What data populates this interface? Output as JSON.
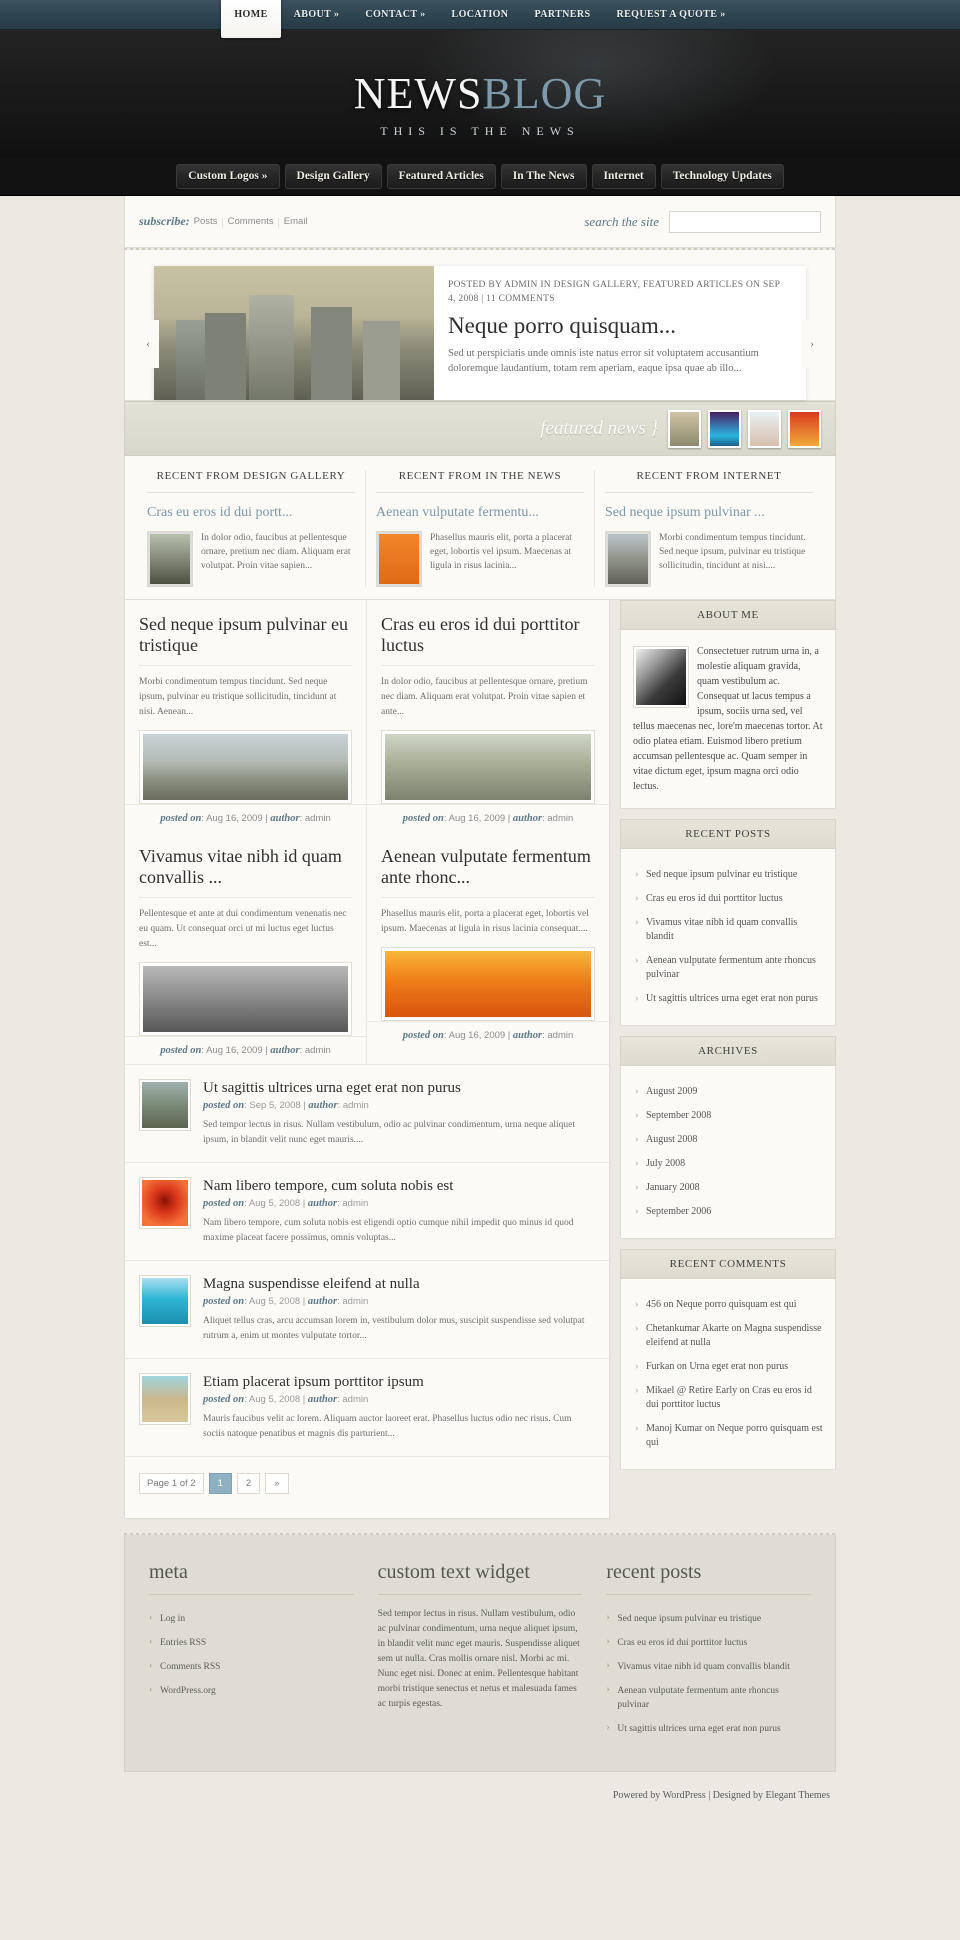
{
  "topnav": {
    "items": [
      {
        "label": "HOME",
        "active": true
      },
      {
        "label": "ABOUT »",
        "active": false
      },
      {
        "label": "CONTACT »",
        "active": false
      },
      {
        "label": "LOCATION",
        "active": false
      },
      {
        "label": "PARTNERS",
        "active": false
      },
      {
        "label": "REQUEST A QUOTE »",
        "active": false
      }
    ]
  },
  "logo": {
    "part1": "NEWS",
    "part2": "BLOG",
    "tagline": "THIS IS THE NEWS"
  },
  "catnav": {
    "items": [
      "Custom Logos »",
      "Design Gallery",
      "Featured Articles",
      "In The News",
      "Internet",
      "Technology Updates"
    ]
  },
  "subscribe": {
    "label": "subscribe:",
    "links": [
      "Posts",
      "Comments",
      "Email"
    ]
  },
  "search": {
    "label": "search the site",
    "placeholder": "",
    "value": ""
  },
  "slider": {
    "meta": "POSTED BY ADMIN IN DESIGN GALLERY, FEATURED ARTICLES ON SEP 4, 2008 | 11 COMMENTS",
    "title": "Neque porro quisquam...",
    "excerpt": "Sed ut perspiciatis unde omnis iste natus error sit voluptatem accusantium doloremque laudantium, totam rem aperiam, eaque ipsa quae ab illo...",
    "prev": "‹",
    "next": "›"
  },
  "featured_bar": {
    "label": "featured news }",
    "thumb_count": 4
  },
  "recent_columns": [
    {
      "heading": "RECENT FROM DESIGN GALLERY",
      "title": "Cras eu eros id dui portt...",
      "excerpt": "In dolor odio, faucibus at pellentesque ornare, pretium nec diam. Aliquam erat volutpat. Proin vitae sapien..."
    },
    {
      "heading": "RECENT FROM IN THE NEWS",
      "title": "Aenean vulputate fermentu...",
      "excerpt": "Phasellus mauris elit, porta a placerat eget, lobortis vel ipsum. Maecenas at ligula in risus lacinia..."
    },
    {
      "heading": "RECENT FROM INTERNET",
      "title": "Sed neque ipsum pulvinar ...",
      "excerpt": "Morbi condimentum tempus tincidunt. Sed neque ipsum, pulvinar eu tristique sollicitudin, tincidunt at nisi...."
    }
  ],
  "grid_posts": [
    {
      "title": "Sed neque ipsum pulvinar eu tristique",
      "excerpt": "Morbi condimentum tempus tincidunt. Sed neque ipsum, pulvinar eu tristique sollicitudin, tincidunt at nisi. Aenean...",
      "posted_label": "posted on",
      "date": "Aug 16, 2009",
      "author_label": "author",
      "author": "admin"
    },
    {
      "title": "Cras eu eros id dui porttitor luctus",
      "excerpt": "In dolor odio, faucibus at pellentesque ornare, pretium nec diam. Aliquam erat volutpat. Proin vitae sapien et ante...",
      "posted_label": "posted on",
      "date": "Aug 16, 2009",
      "author_label": "author",
      "author": "admin"
    },
    {
      "title": "Vivamus vitae nibh id quam convallis ...",
      "excerpt": "Pellentesque et ante at dui condimentum venenatis nec eu quam. Ut consequat orci ut mi luctus eget luctus est...",
      "posted_label": "posted on",
      "date": "Aug 16, 2009",
      "author_label": "author",
      "author": "admin"
    },
    {
      "title": "Aenean vulputate fermentum ante rhonc...",
      "excerpt": "Phasellus mauris elit, porta a placerat eget, lobortis vel ipsum. Maecenas at ligula in risus lacinia consequat....",
      "posted_label": "posted on",
      "date": "Aug 16, 2009",
      "author_label": "author",
      "author": "admin"
    }
  ],
  "list_posts": [
    {
      "title": "Ut sagittis ultrices urna eget erat non purus",
      "posted_label": "posted on",
      "date": "Sep 5, 2008",
      "author_label": "author",
      "author": "admin",
      "excerpt": "Sed tempor lectus in risus. Nullam vestibulum, odio ac pulvinar condimentum, urna neque aliquet ipsum, in blandit velit nunc eget mauris...."
    },
    {
      "title": "Nam libero tempore, cum soluta nobis est",
      "posted_label": "posted on",
      "date": "Aug 5, 2008",
      "author_label": "author",
      "author": "admin",
      "excerpt": "Nam libero tempore, cum soluta nobis est eligendi optio cumque nihil impedit quo minus id quod maxime placeat facere possimus, omnis voluptas..."
    },
    {
      "title": "Magna suspendisse eleifend at nulla",
      "posted_label": "posted on",
      "date": "Aug 5, 2008",
      "author_label": "author",
      "author": "admin",
      "excerpt": "Aliquet tellus cras, arcu accumsan lorem in, vestibulum dolor mus, suscipit suspendisse sed volutpat rutrum a, enim ut montes vulputate tortor..."
    },
    {
      "title": "Etiam placerat ipsum porttitor ipsum",
      "posted_label": "posted on",
      "date": "Aug 5, 2008",
      "author_label": "author",
      "author": "admin",
      "excerpt": "Mauris faucibus velit ac lorem. Aliquam auctor laoreet erat. Phasellus luctus odio nec risus. Cum sociis natoque penatibus et magnis dis parturient..."
    }
  ],
  "pager": {
    "info": "Page 1 of 2",
    "pages": [
      "1",
      "2"
    ],
    "current": "1",
    "next": "»"
  },
  "sidebar": {
    "about": {
      "heading": "ABOUT ME",
      "text": "Consectetuer rutrum urna in, a molestie aliquam gravida, quam vestibulum ac. Consequat ut lacus tempus a ipsum, sociis urna sed, vel tellus maecenas nec, lore'm maecenas tortor. At odio platea etiam. Euismod libero pretium accumsan pellentesque ac. Quam semper in vitae dictum eget, ipsum magna orci odio lectus."
    },
    "recent_posts": {
      "heading": "RECENT POSTS",
      "items": [
        "Sed neque ipsum pulvinar eu tristique",
        "Cras eu eros id dui porttitor luctus",
        "Vivamus vitae nibh id quam convallis blandit",
        "Aenean vulputate fermentum ante rhoncus pulvinar",
        "Ut sagittis ultrices urna eget erat non purus"
      ]
    },
    "archives": {
      "heading": "ARCHIVES",
      "items": [
        "August 2009",
        "September 2008",
        "August 2008",
        "July 2008",
        "January 2008",
        "September 2006"
      ]
    },
    "recent_comments": {
      "heading": "RECENT COMMENTS",
      "items": [
        "456 on Neque porro quisquam est qui",
        "Chetankumar Akarte on Magna suspendisse eleifend at nulla",
        "Furkan on Urna eget erat non purus",
        "Mikael @ Retire Early on Cras eu eros id dui porttitor luctus",
        "Manoj Kumar on Neque porro quisquam est qui"
      ]
    }
  },
  "footer": {
    "meta": {
      "heading": "meta",
      "items": [
        "Log in",
        "Entries RSS",
        "Comments RSS",
        "WordPress.org"
      ]
    },
    "custom_text": {
      "heading": "custom text widget",
      "text": "Sed tempor lectus in risus. Nullam vestibulum, odio ac pulvinar condimentum, urna neque aliquet ipsum, in blandit velit nunc eget mauris. Suspendisse aliquet sem ut nulla. Cras mollis ornare nisl. Morbi ac mi. Nunc eget nisi. Donec at enim. Pellentesque habitant morbi tristique senectus et netus et malesuada fames ac turpis egestas."
    },
    "recent_posts": {
      "heading": "recent posts",
      "items": [
        "Sed neque ipsum pulvinar eu tristique",
        "Cras eu eros id dui porttitor luctus",
        "Vivamus vitae nibh id quam convallis blandit",
        "Aenean vulputate fermentum ante rhoncus pulvinar",
        "Ut sagittis ultrices urna eget erat non purus"
      ]
    },
    "credit": "Powered by WordPress | Designed by Elegant Themes"
  }
}
